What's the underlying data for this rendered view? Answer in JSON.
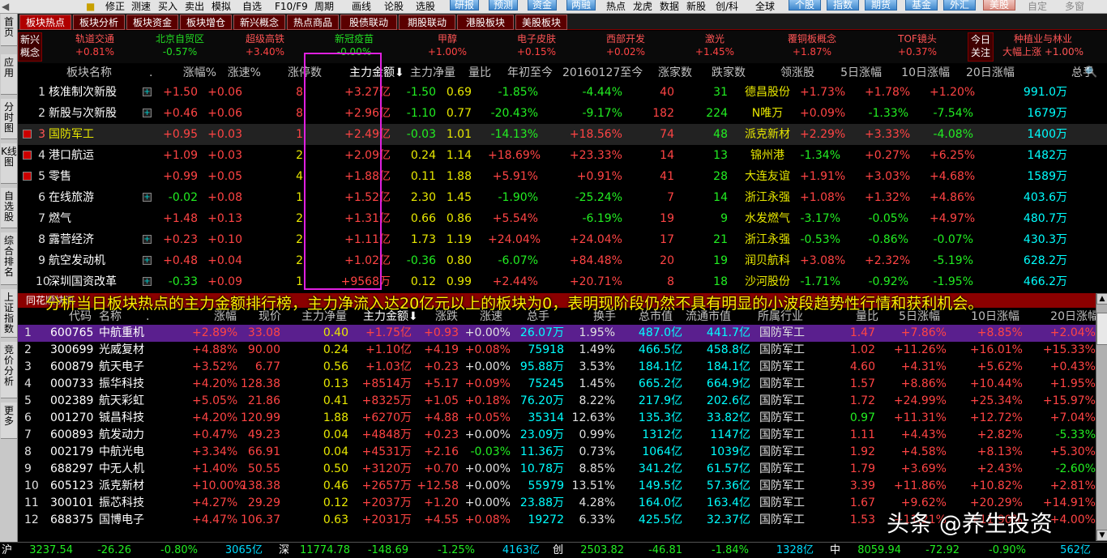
{
  "toolbar": {
    "items": [
      "修正",
      "测速",
      "买入",
      "卖出",
      "模拟",
      "自选",
      "F10/F9",
      "周期",
      "画线",
      "论股",
      "选股",
      "研报",
      "预测",
      "资金",
      "两融",
      "热点",
      "龙虎",
      "数据",
      "新股",
      "创/科",
      "全球",
      "个股",
      "指数",
      "期货",
      "基金",
      "外汇",
      "美股",
      "自定",
      "多窗"
    ]
  },
  "tabs": [
    "板块热点",
    "板块分析",
    "板块资金",
    "板块增仓",
    "新兴概念",
    "热点商品",
    "股债联动",
    "期股联动",
    "港股板块",
    "美股板块"
  ],
  "side": [
    "首页",
    "应用",
    "分时图",
    "K线图",
    "自选股",
    "综合排名",
    "上证指数",
    "竞价分析",
    "更多"
  ],
  "ticker": [
    {
      "name": "新兴\n概念",
      "val": ""
    },
    {
      "name": "轨道交通",
      "val": "+0.81%"
    },
    {
      "name": "北京自贸区",
      "val": "-0.57%"
    },
    {
      "name": "超级高铁",
      "val": "+3.40%"
    },
    {
      "name": "新冠疫苗",
      "val": "-0.00%"
    },
    {
      "name": "甲醇",
      "val": "+1.00%"
    },
    {
      "name": "电子皮肤",
      "val": "+0.15%"
    },
    {
      "name": "西部开发",
      "val": "+0.02%"
    },
    {
      "name": "激光",
      "val": "+1.45%"
    },
    {
      "name": "覆铜板概念",
      "val": "+1.87%"
    },
    {
      "name": "TOF镜头",
      "val": "+0.37%"
    },
    {
      "name": "今日\n关注",
      "val": ""
    },
    {
      "name": "种植业与林业",
      "val": "大幅上涨 +1.00%"
    }
  ],
  "board_headers": [
    "板块名称",
    ".",
    "涨幅%",
    "涨速%",
    "涨停数",
    "主力金额",
    "主力净量",
    "量比",
    "年初至今",
    "20160127至今",
    "涨家数",
    "跌家数",
    "领涨股",
    "5日涨幅",
    "10日涨幅",
    "20日涨幅",
    "总手"
  ],
  "boards": [
    [
      "1",
      "核准制次新股",
      "+1.50",
      "+0.06",
      "8",
      "+3.27亿",
      "-1.50",
      "0.69",
      "-1.85%",
      "-4.44%",
      "40",
      "31",
      "德昌股份",
      "+1.73%",
      "+1.78%",
      "+1.20%",
      "991.0万"
    ],
    [
      "2",
      "新股与次新股",
      "+0.46",
      "+0.06",
      "8",
      "+2.96亿",
      "-1.10",
      "0.77",
      "-20.43%",
      "-9.17%",
      "182",
      "224",
      "N唯万",
      "+0.09%",
      "-1.33%",
      "-7.54%",
      "1679万"
    ],
    [
      "3",
      "国防军工",
      "+0.95",
      "+0.03",
      "1",
      "+2.49亿",
      "-0.03",
      "1.01",
      "-14.13%",
      "+18.56%",
      "74",
      "48",
      "派克新材",
      "+2.29%",
      "+3.33%",
      "-4.08%",
      "1400万"
    ],
    [
      "4",
      "港口航运",
      "+1.09",
      "+0.03",
      "2",
      "+2.09亿",
      "0.24",
      "1.14",
      "+18.69%",
      "+23.33%",
      "14",
      "13",
      "锦州港",
      "-1.34%",
      "+0.27%",
      "+6.25%",
      "1482万"
    ],
    [
      "5",
      "零售",
      "+0.99",
      "+0.05",
      "4",
      "+1.88亿",
      "0.11",
      "1.88",
      "+5.91%",
      "+0.91%",
      "41",
      "28",
      "大连友谊",
      "+1.91%",
      "+3.03%",
      "+4.68%",
      "1589万"
    ],
    [
      "6",
      "在线旅游",
      "-0.02",
      "+0.08",
      "1",
      "+1.52亿",
      "2.30",
      "1.45",
      "-1.90%",
      "-25.24%",
      "7",
      "14",
      "浙江永强",
      "+1.08%",
      "+1.32%",
      "+4.86%",
      "403.6万"
    ],
    [
      "7",
      "燃气",
      "+1.48",
      "+0.13",
      "2",
      "+1.31亿",
      "0.66",
      "0.86",
      "+5.54%",
      "-6.19%",
      "19",
      "9",
      "水发燃气",
      "-3.17%",
      "-0.05%",
      "+4.97%",
      "480.7万"
    ],
    [
      "8",
      "露营经济",
      "+0.23",
      "+0.10",
      "2",
      "+1.11亿",
      "1.73",
      "1.19",
      "+24.04%",
      "+24.04%",
      "17",
      "21",
      "浙江永强",
      "-0.53%",
      "-0.86%",
      "-0.07%",
      "430.3万"
    ],
    [
      "9",
      "航空发动机",
      "+0.48",
      "+0.04",
      "2",
      "+1.02亿",
      "-0.36",
      "0.80",
      "-6.07%",
      "+84.48%",
      "20",
      "19",
      "润贝航科",
      "+3.08%",
      "+2.32%",
      "-5.19%",
      "628.2万"
    ],
    [
      "10",
      "深圳国资改革",
      "-0.33",
      "+0.09",
      "1",
      "+9568万",
      "0.12",
      "0.99",
      "+2.44%",
      "+20.71%",
      "8",
      "18",
      "沙河股份",
      "-1.71%",
      "-0.92%",
      "-1.95%",
      "466.2万"
    ]
  ],
  "lower_tab": "同花顺快讯",
  "caption": "分析当日板块热点的主力金额排行榜，主力净流入达20亿元以上的板块为0，表明现阶段仍然不具有明显的小波段趋势性行情和获利机会。",
  "stock_headers": [
    "代码",
    "名称",
    ".",
    "涨幅",
    "现价",
    "主力净量",
    "主力金额",
    "涨跌",
    "涨速",
    "总手",
    "换手",
    "总市值",
    "流通市值",
    "所属行业",
    "量比",
    "5日涨幅",
    "10日涨幅",
    "20日涨幅"
  ],
  "stocks": [
    [
      "1",
      "600765",
      "中航重机",
      "+2.89%",
      "33.08",
      "0.40",
      "+1.75亿",
      "+0.93",
      "+0.00%",
      "26.07万",
      "1.95%",
      "487.0亿",
      "441.7亿",
      "国防军工",
      "1.47",
      "+7.86%",
      "+8.85%",
      "+2.04%"
    ],
    [
      "2",
      "300699",
      "光威复材",
      "+4.88%",
      "90.00",
      "0.24",
      "+1.10亿",
      "+4.19",
      "+0.08%",
      "75918",
      "1.49%",
      "466.5亿",
      "458.8亿",
      "国防军工",
      "1.02",
      "+11.26%",
      "+16.01%",
      "+15.33%"
    ],
    [
      "3",
      "600879",
      "航天电子",
      "+3.52%",
      "6.77",
      "0.56",
      "+1.03亿",
      "+0.23",
      "+0.00%",
      "95.88万",
      "3.53%",
      "184.1亿",
      "184.1亿",
      "国防军工",
      "4.60",
      "+4.31%",
      "+5.62%",
      "+0.43%"
    ],
    [
      "4",
      "000733",
      "振华科技",
      "+4.20%",
      "128.38",
      "0.13",
      "+8514万",
      "+5.17",
      "+0.09%",
      "75245",
      "1.45%",
      "665.2亿",
      "664.9亿",
      "国防军工",
      "1.57",
      "+8.86%",
      "+10.44%",
      "+1.95%"
    ],
    [
      "5",
      "002389",
      "航天彩虹",
      "+5.05%",
      "21.86",
      "0.41",
      "+8325万",
      "+1.05",
      "+0.18%",
      "76.20万",
      "8.22%",
      "217.9亿",
      "202.6亿",
      "国防军工",
      "1.72",
      "+24.99%",
      "+25.34%",
      "+15.97%"
    ],
    [
      "6",
      "001270",
      "铖昌科技",
      "+4.20%",
      "120.99",
      "1.88",
      "+6270万",
      "+4.88",
      "+0.05%",
      "35314",
      "12.63%",
      "135.3亿",
      "33.82亿",
      "国防军工",
      "0.97",
      "+11.31%",
      "+12.72%",
      "+7.04%"
    ],
    [
      "7",
      "600893",
      "航发动力",
      "+0.47%",
      "49.23",
      "0.04",
      "+4848万",
      "+0.23",
      "+0.00%",
      "23.09万",
      "0.99%",
      "1312亿",
      "1147亿",
      "国防军工",
      "1.11",
      "+4.43%",
      "+2.82%",
      "-5.33%"
    ],
    [
      "8",
      "002179",
      "中航光电",
      "+3.34%",
      "66.91",
      "0.04",
      "+4531万",
      "+2.16",
      "-0.03%",
      "11.36万",
      "0.73%",
      "1064亿",
      "1039亿",
      "国防军工",
      "1.92",
      "+4.58%",
      "+8.13%",
      "+5.30%"
    ],
    [
      "9",
      "688297",
      "中无人机",
      "+1.40%",
      "50.55",
      "0.50",
      "+3120万",
      "+0.70",
      "+0.00%",
      "10.78万",
      "8.85%",
      "341.2亿",
      "61.57亿",
      "国防军工",
      "1.79",
      "+3.69%",
      "+2.43%",
      "-2.60%"
    ],
    [
      "10",
      "605123",
      "派克新材",
      "+10.00%",
      "138.38",
      "0.46",
      "+2657万",
      "+12.58",
      "+0.00%",
      "55979",
      "13.51%",
      "149.5亿",
      "57.36亿",
      "国防军工",
      "3.39",
      "+11.86%",
      "+10.82%",
      "+2.81%"
    ],
    [
      "11",
      "300101",
      "振芯科技",
      "+4.27%",
      "29.29",
      "0.12",
      "+2037万",
      "+1.20",
      "+0.00%",
      "23.88万",
      "4.28%",
      "164.0亿",
      "163.4亿",
      "国防军工",
      "1.67",
      "+9.62%",
      "+20.29%",
      "+14.91%"
    ],
    [
      "12",
      "688375",
      "国博电子",
      "+4.47%",
      "106.37",
      "0.63",
      "+2031万",
      "+4.55",
      "+0.08%",
      "19272",
      "6.33%",
      "425.5亿",
      "32.37亿",
      "国防军工",
      "1.53",
      "+11.21%",
      "+11.90%",
      "+4.00%"
    ]
  ],
  "status": {
    "sh_label": "沪",
    "sh": [
      "3237.54",
      "-26.26",
      "-0.80%",
      "3065亿"
    ],
    "sz_label": "深",
    "sz": [
      "11774.78",
      "-148.69",
      "-1.25%",
      "4163亿"
    ],
    "cy_label": "创",
    "cy": [
      "2503.82",
      "-46.81",
      "-1.84%",
      "1328亿"
    ],
    "zh_label": "中",
    "zh": [
      "8059.94",
      "-72.92",
      "-0.90%",
      "562亿"
    ]
  },
  "watermark": "头条 @养生投资"
}
